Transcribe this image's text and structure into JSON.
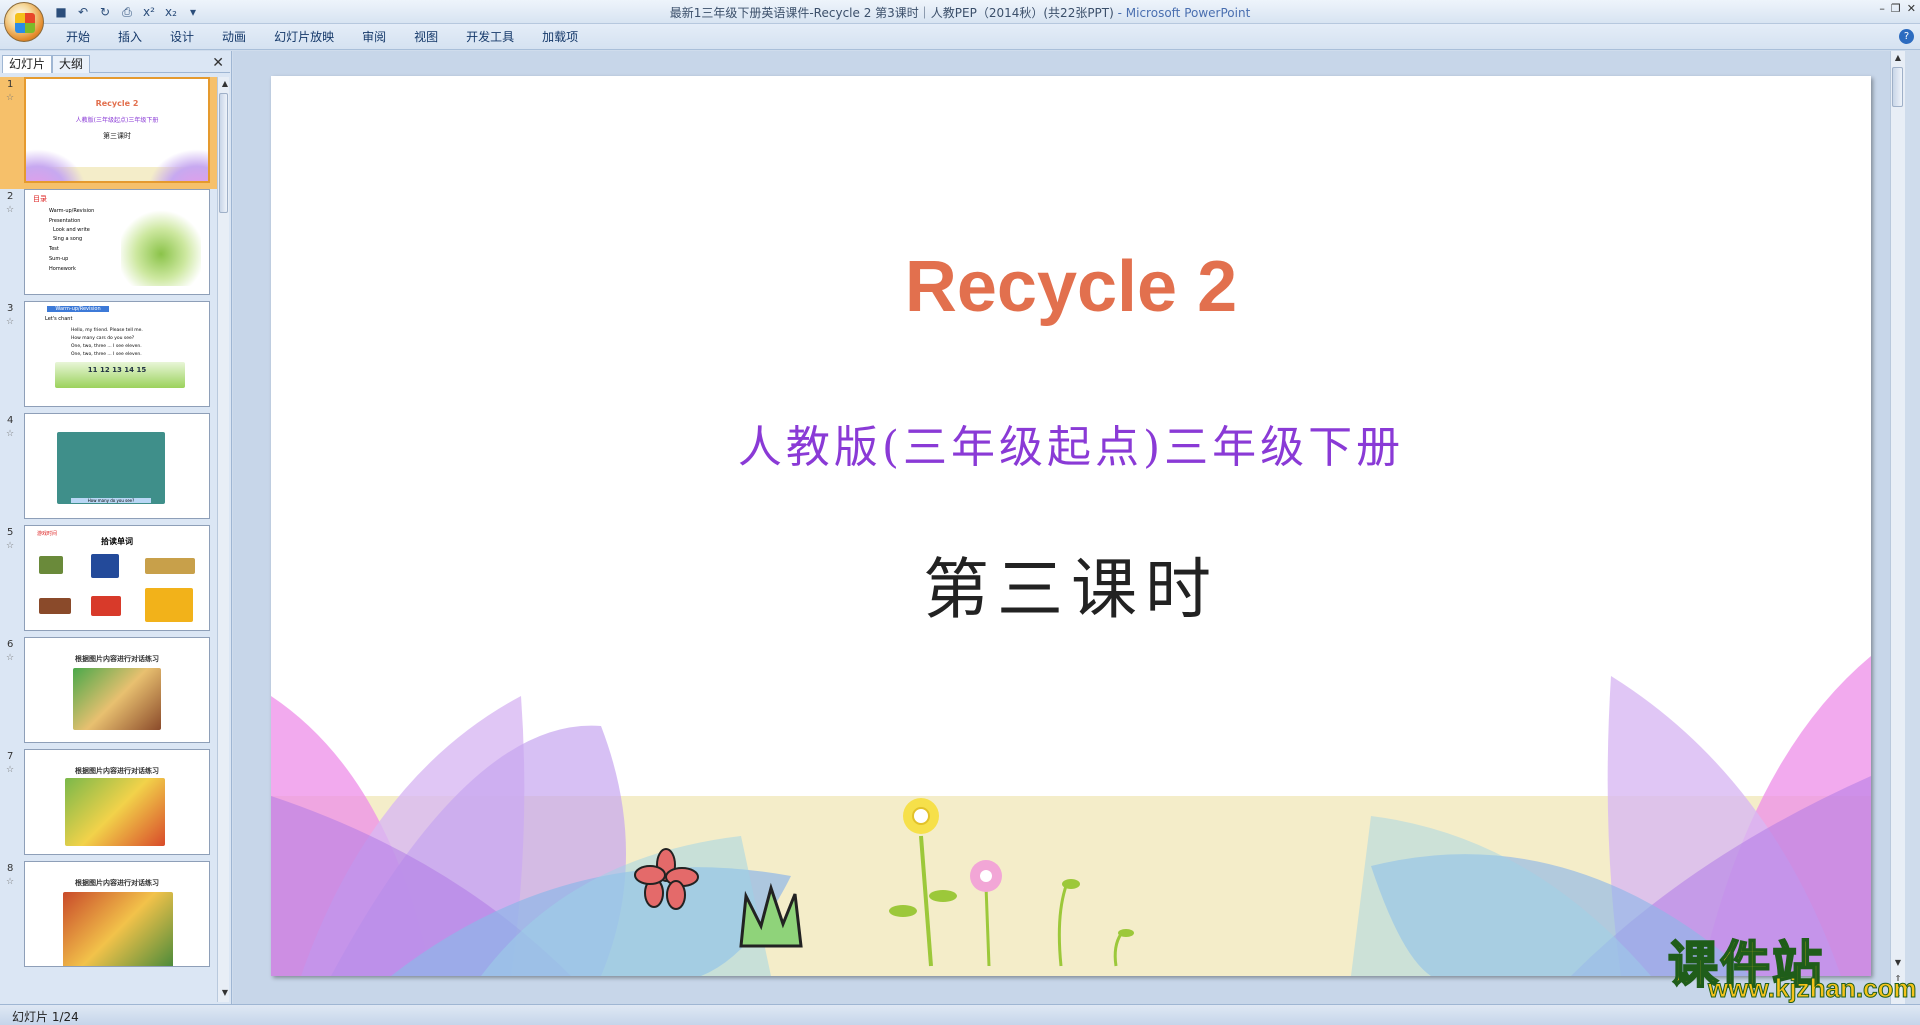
{
  "window": {
    "title": "最新1三年级下册英语课件-Recycle 2 第3课时｜人教PEP（2014秋）(共22张PPT)",
    "app_suffix": " - Microsoft PowerPoint"
  },
  "quick_access": {
    "icons": [
      "save-icon",
      "undo-icon",
      "redo-icon",
      "print-preview-icon",
      "superscript-icon",
      "subscript-icon",
      "customize-dropdown-icon"
    ],
    "glyphs": [
      "■",
      "↶",
      "↻",
      "⎙",
      "x²",
      "x₂",
      "▾"
    ]
  },
  "window_controls": {
    "minimize": "–",
    "restore": "❐",
    "close": "✕"
  },
  "ribbon": {
    "tabs": [
      "开始",
      "插入",
      "设计",
      "动画",
      "幻灯片放映",
      "审阅",
      "视图",
      "开发工具",
      "加载项"
    ],
    "help": "?"
  },
  "left_pane": {
    "tabs": [
      "幻灯片",
      "大纲"
    ],
    "close": "✕",
    "selected_index": 0,
    "thumbnails": [
      {
        "num": "1",
        "texts": [
          "Recycle  2",
          "人教版(三年级起点)三年级下册",
          "第三课时"
        ]
      },
      {
        "num": "2",
        "texts": [
          "目录",
          "Warm-up/Revision",
          "Presentation",
          "Look and write",
          "Sing a song",
          "Test",
          "Sum-up",
          "Homework"
        ]
      },
      {
        "num": "3",
        "texts": [
          "Warm-up/Revision",
          "Let's chant",
          "Hello, my friend. Please tell me.",
          "How many cars do you see?",
          "One, two, three ... I see eleven.",
          "One, two, three ... I see eleven.",
          "11  12  13  14  15"
        ]
      },
      {
        "num": "4",
        "texts": [
          "How many do you see?"
        ]
      },
      {
        "num": "5",
        "texts": [
          "游戏时间",
          "拾读单词"
        ]
      },
      {
        "num": "6",
        "texts": [
          "根据图片内容进行对话练习"
        ]
      },
      {
        "num": "7",
        "texts": [
          "根据图片内容进行对话练习"
        ]
      },
      {
        "num": "8",
        "texts": [
          "根据图片内容进行对话练习"
        ]
      }
    ]
  },
  "slide": {
    "title": "Recycle 2",
    "subtitle": "人教版(三年级起点)三年级下册",
    "lesson": "第三课时",
    "colors": {
      "title": "#e2704e",
      "subtitle": "#8a3ad6",
      "lesson": "#222222"
    }
  },
  "status": {
    "slide_indicator": "幻灯片 1/24"
  },
  "watermark": {
    "text_cn": "课件站",
    "url": "www.kjzhan.com"
  }
}
